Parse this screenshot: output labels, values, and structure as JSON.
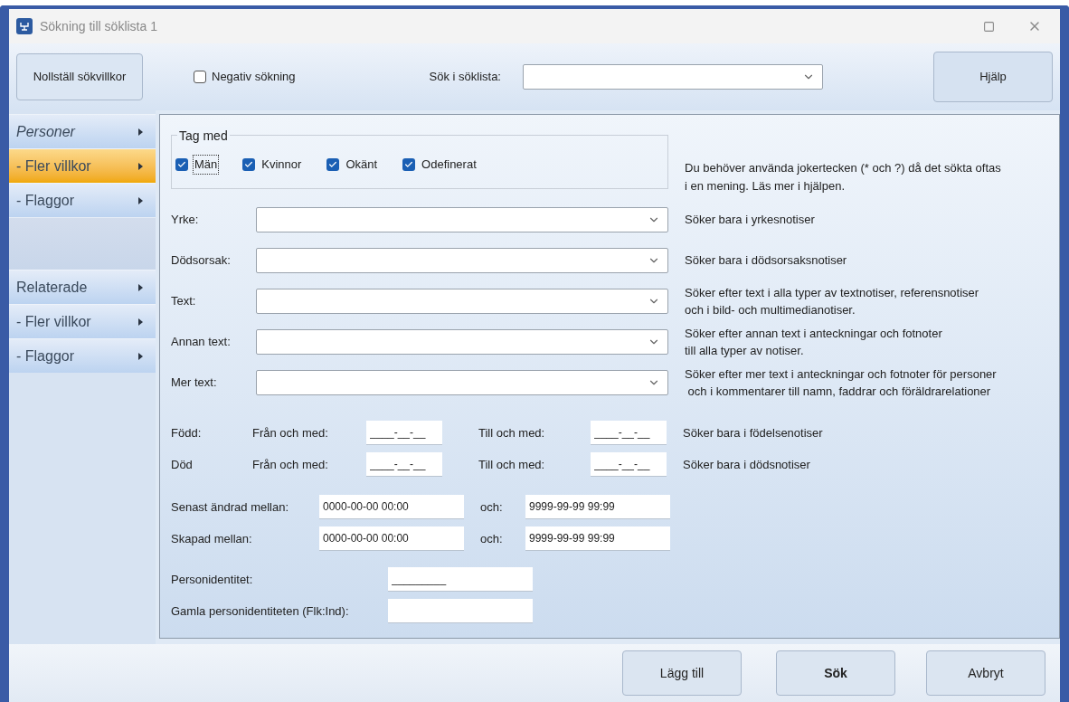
{
  "window": {
    "title": "Sökning till söklista 1"
  },
  "toolbar": {
    "reset_button": "Nollställ sökvillkor",
    "negative_search": {
      "label": "Negativ sökning",
      "checked": false
    },
    "search_in_list": {
      "label": "Sök i söklista:"
    },
    "help_button": "Hjälp"
  },
  "sidebar": {
    "items": [
      {
        "label": "Personer",
        "kind": "group",
        "italic": true,
        "selected": false
      },
      {
        "label": "- Fler villkor",
        "kind": "sub",
        "italic": false,
        "selected": true
      },
      {
        "label": "- Flaggor",
        "kind": "sub",
        "italic": false,
        "selected": false
      },
      {
        "kind": "spacer"
      },
      {
        "label": "Relaterade",
        "kind": "group",
        "italic": false,
        "selected": false
      },
      {
        "label": "- Fler villkor",
        "kind": "sub",
        "italic": false,
        "selected": false
      },
      {
        "label": "- Flaggor",
        "kind": "sub",
        "italic": false,
        "selected": false
      }
    ]
  },
  "include": {
    "title": "Tag med",
    "options": [
      {
        "label": "Män",
        "checked": true,
        "focused": true
      },
      {
        "label": "Kvinnor",
        "checked": true,
        "focused": false
      },
      {
        "label": "Okänt",
        "checked": true,
        "focused": false
      },
      {
        "label": "Odefinerat",
        "checked": true,
        "focused": false
      }
    ],
    "hint": "Du behöver använda jokertecken (* och ?) då det sökta oftas\ni en mening. Läs mer i hjälpen."
  },
  "text_fields": [
    {
      "label": "Yrke:",
      "hint": "Söker bara i yrkesnotiser"
    },
    {
      "label": "Dödsorsak:",
      "hint": "Söker bara i dödsorsaksnotiser"
    },
    {
      "label": "Text:",
      "hint": "Söker efter text i alla typer av textnotiser, referensnotiser\noch i bild- och multimedianotiser."
    },
    {
      "label": "Annan text:",
      "hint": "Söker efter annan text i anteckningar och fotnoter\ntill alla typer av notiser."
    },
    {
      "label": "Mer text:",
      "hint": "Söker efter mer text i anteckningar och fotnoter för personer\n och i kommentarer till namn, faddrar och föräldrarelationer"
    }
  ],
  "date_rows": [
    {
      "label": "Född:",
      "from_label": "Från och med:",
      "from_value": "____-__-__",
      "to_label": "Till och med:",
      "to_value": "____-__-__",
      "hint": "Söker bara i födelsenotiser"
    },
    {
      "label": "Död",
      "from_label": "Från och med:",
      "from_value": "____-__-__",
      "to_label": "Till och med:",
      "to_value": "____-__-__",
      "hint": "Söker bara i dödsnotiser"
    }
  ],
  "time_rows": [
    {
      "label": "Senast ändrad mellan:",
      "from_value": "0000-00-00 00:00",
      "and_label": "och:",
      "to_value": "9999-99-99 99:99"
    },
    {
      "label": "Skapad mellan:",
      "from_value": "0000-00-00 00:00",
      "and_label": "och:",
      "to_value": "9999-99-99 99:99"
    }
  ],
  "identity_rows": [
    {
      "label": "Personidentitet:",
      "value": "_________"
    },
    {
      "label": "Gamla personidentiteten (Flk:Ind):"
    }
  ],
  "buttons": [
    {
      "label": "Lägg till",
      "primary": false
    },
    {
      "label": "Sök",
      "primary": true
    },
    {
      "label": "Avbryt",
      "primary": false
    }
  ]
}
